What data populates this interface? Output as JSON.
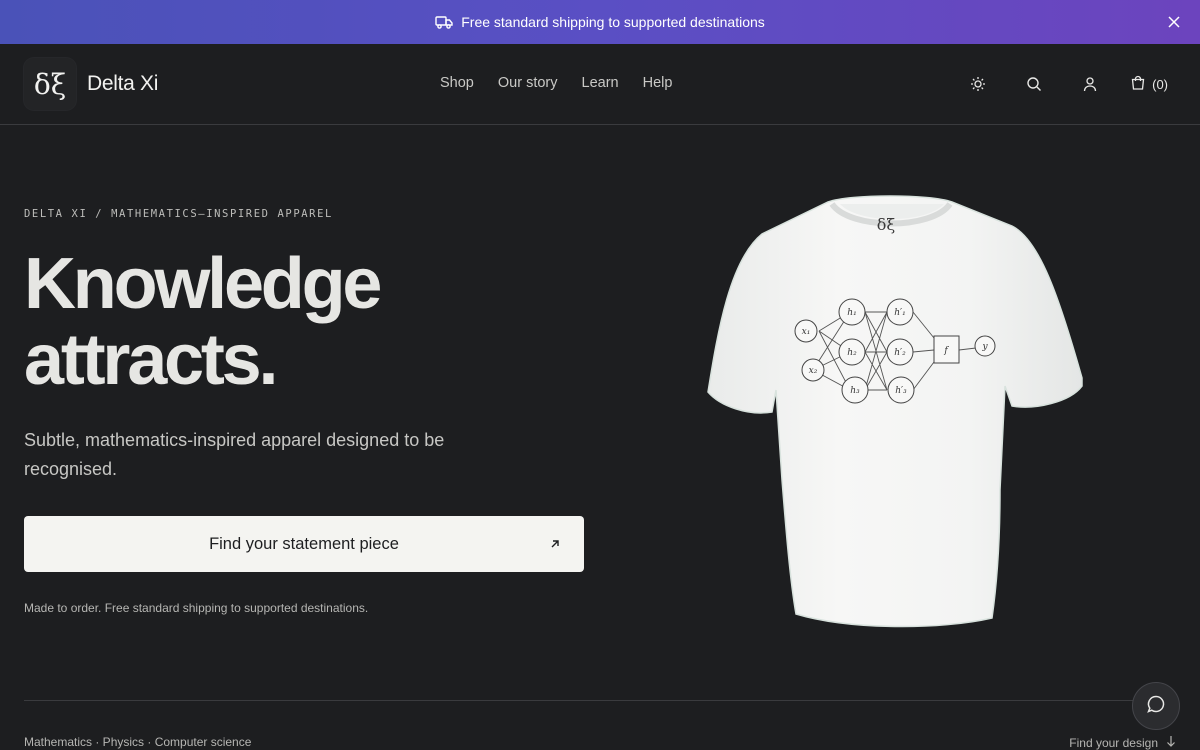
{
  "announcement": {
    "text": "Free standard shipping to supported destinations",
    "icon": "truck-icon",
    "close_icon": "close-icon"
  },
  "header": {
    "logo_glyph": "δξ",
    "brand": "Delta Xi",
    "nav": [
      "Shop",
      "Our story",
      "Learn",
      "Help"
    ],
    "icons": [
      "sun-icon",
      "search-icon",
      "account-icon",
      "cart-icon"
    ],
    "cart_count": "(0)"
  },
  "hero": {
    "eyebrow": "DELTA XI / MATHEMATICS–INSPIRED APPAREL",
    "headline_line1": "Knowledge",
    "headline_line2": "attracts.",
    "subhead": "Subtle, mathematics-inspired apparel designed to be recognised.",
    "cta_label": "Find your statement piece",
    "note": "Made to order. Free standard shipping to supported destinations."
  },
  "product_image": {
    "logo": "δξ",
    "diagram_inputs": [
      "x₁",
      "x₂"
    ],
    "diagram_hidden1": [
      "h₁",
      "h₂",
      "h₃"
    ],
    "diagram_hidden2": [
      "h′₁",
      "h′₂",
      "h′₃"
    ],
    "diagram_func": "f",
    "diagram_output": "y"
  },
  "footer": {
    "disciplines": "Mathematics · Physics · Computer science",
    "find_design": "Find your design"
  },
  "colors": {
    "background": "#1d1e20",
    "announcement_gradient": [
      "#4a52b8",
      "#6c44be"
    ],
    "cta_background": "#f4f4f1"
  }
}
